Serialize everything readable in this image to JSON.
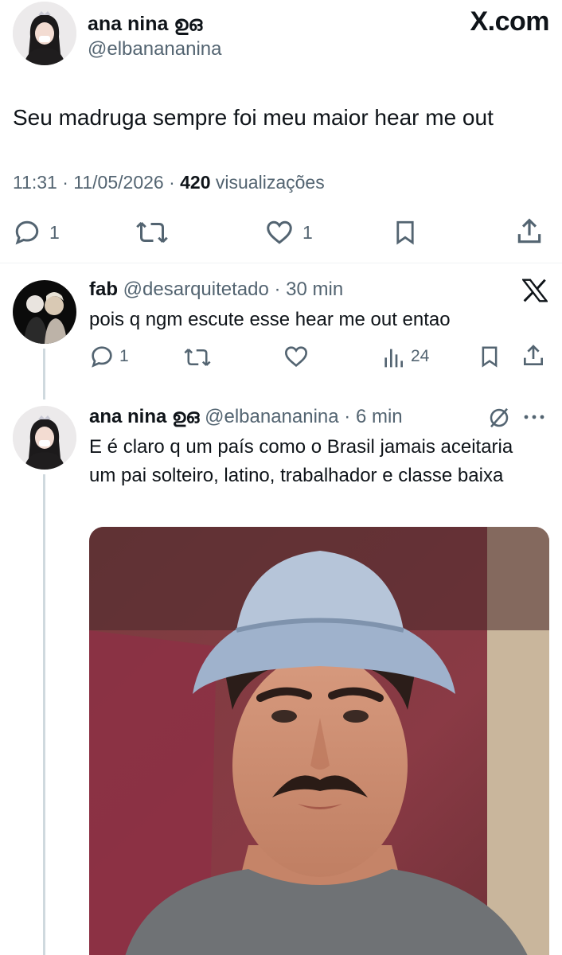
{
  "main_tweet": {
    "author_name": "ana nina ஐஐ",
    "author_display": "ana nina ഉഒ",
    "handle": "@elbanananina",
    "brand": "X.com",
    "text": "Seu madruga sempre foi meu maior hear me out",
    "time": "11:31 · 11/05/2026 · ",
    "views_count": "420",
    "views_label": " visualizações",
    "replies": "1",
    "likes": "1"
  },
  "reply_1": {
    "name": "fab",
    "handle_time": "@desarquitetado · 30 min",
    "text": "pois q ngm escute esse hear me out entao",
    "replies": "1",
    "views": "24"
  },
  "reply_2": {
    "name": "ana nina ഉഒ",
    "handle_time": "@elbanananina · 6 min",
    "text": "E é claro q um país como o Brasil jamais aceitaria um pai solteiro, latino, trabalhador e classe baixa"
  },
  "icons": [
    "reply-icon",
    "retweet-icon",
    "like-icon",
    "bookmark-icon",
    "share-icon",
    "views-icon",
    "x-logo-icon",
    "no-reply-icon",
    "more-icon"
  ],
  "colors": {
    "text": "#0f1419",
    "secondary": "#536471",
    "divider": "#eff3f4",
    "thread": "#cfd9de"
  }
}
